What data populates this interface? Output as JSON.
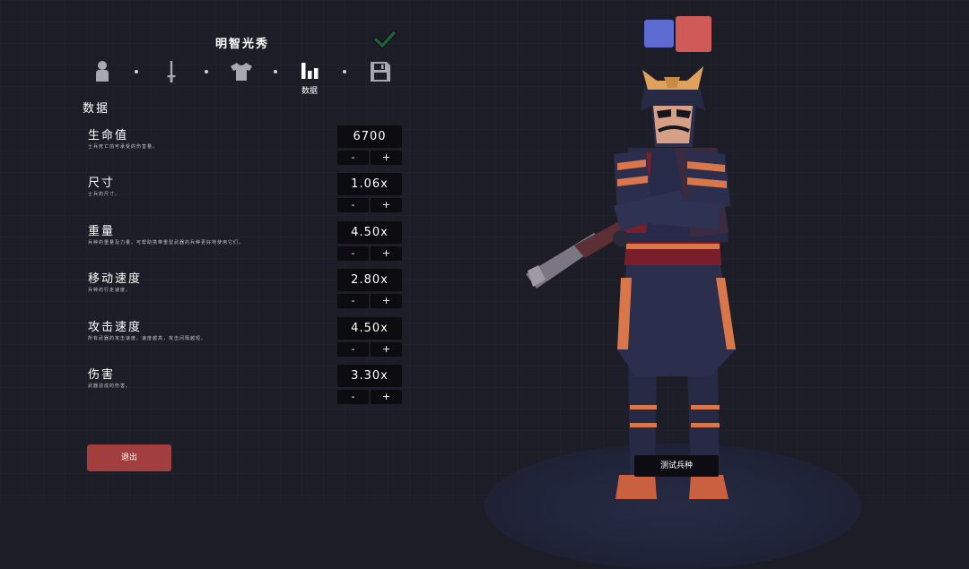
{
  "unit": {
    "name": "明智光秀"
  },
  "steps": {
    "active_label": "数据",
    "icons": [
      "person-icon",
      "sword-icon",
      "shirt-icon",
      "stats-icon",
      "save-icon"
    ]
  },
  "section": {
    "title": "数据"
  },
  "stats": [
    {
      "name": "生命值",
      "desc": "士兵死亡前可承受的伤害量。",
      "value": "6700"
    },
    {
      "name": "尺寸",
      "desc": "士兵的尺寸。",
      "value": "1.06x"
    },
    {
      "name": "重量",
      "desc": "兵种的重量及力量。可帮助携带重型武器的兵种更好地使用它们。",
      "value": "4.50x"
    },
    {
      "name": "移动速度",
      "desc": "兵种的行走速度。",
      "value": "2.80x"
    },
    {
      "name": "攻击速度",
      "desc": "所有武器的攻击速度。速度越高，攻击间隔越短。",
      "value": "4.50x"
    },
    {
      "name": "伤害",
      "desc": "武器造成的伤害。",
      "value": "3.30x"
    }
  ],
  "buttons": {
    "minus": "-",
    "plus": "+",
    "exit": "退出",
    "test": "测试兵种"
  },
  "colors": {
    "team_blue": "#5d6bd3",
    "team_red": "#cf5a57",
    "exit": "#a23e3d",
    "check": "#1f5f3a",
    "background": "#1d1d27"
  }
}
